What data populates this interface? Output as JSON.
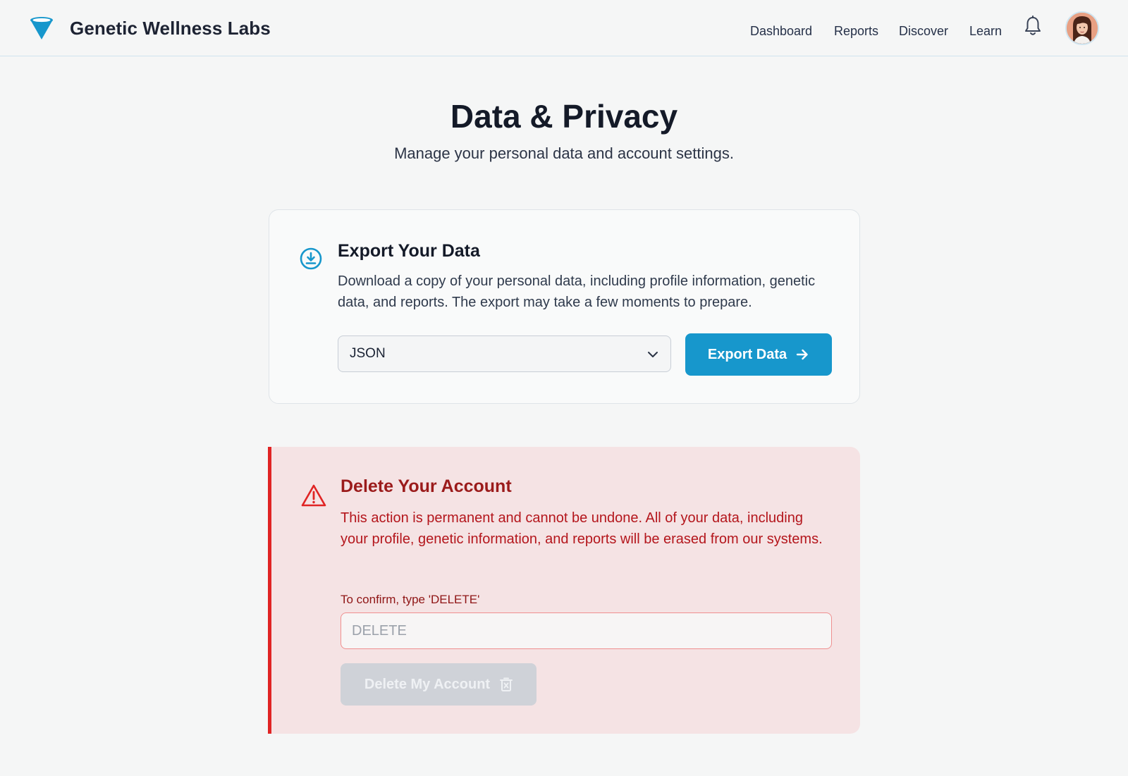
{
  "header": {
    "brand_name": "Genetic Wellness Labs",
    "nav": [
      "Dashboard",
      "Reports",
      "Discover",
      "Learn"
    ]
  },
  "page": {
    "title": "Data & Privacy",
    "subtitle": "Manage your personal data and account settings."
  },
  "export": {
    "title": "Export Your Data",
    "description": "Download a copy of your personal data, including profile information, genetic data, and reports. The export may take a few moments to prepare.",
    "format_selected": "JSON",
    "button_label": "Export Data"
  },
  "delete": {
    "title": "Delete Your Account",
    "description": "This action is permanent and cannot be undone. All of your data, including your profile, genetic information, and reports will be erased from our systems.",
    "confirm_label": "To confirm, type 'DELETE'",
    "confirm_placeholder": "DELETE",
    "button_label": "Delete My Account"
  },
  "colors": {
    "accent": "#1797cc",
    "danger": "#e02424",
    "danger_bg": "#f5e3e4",
    "disabled": "#cfd2d8"
  },
  "icons": [
    "brand-logo-icon",
    "bell-icon",
    "avatar",
    "download-icon",
    "chevron-down-icon",
    "arrow-right-icon",
    "warning-icon",
    "trash-icon"
  ]
}
